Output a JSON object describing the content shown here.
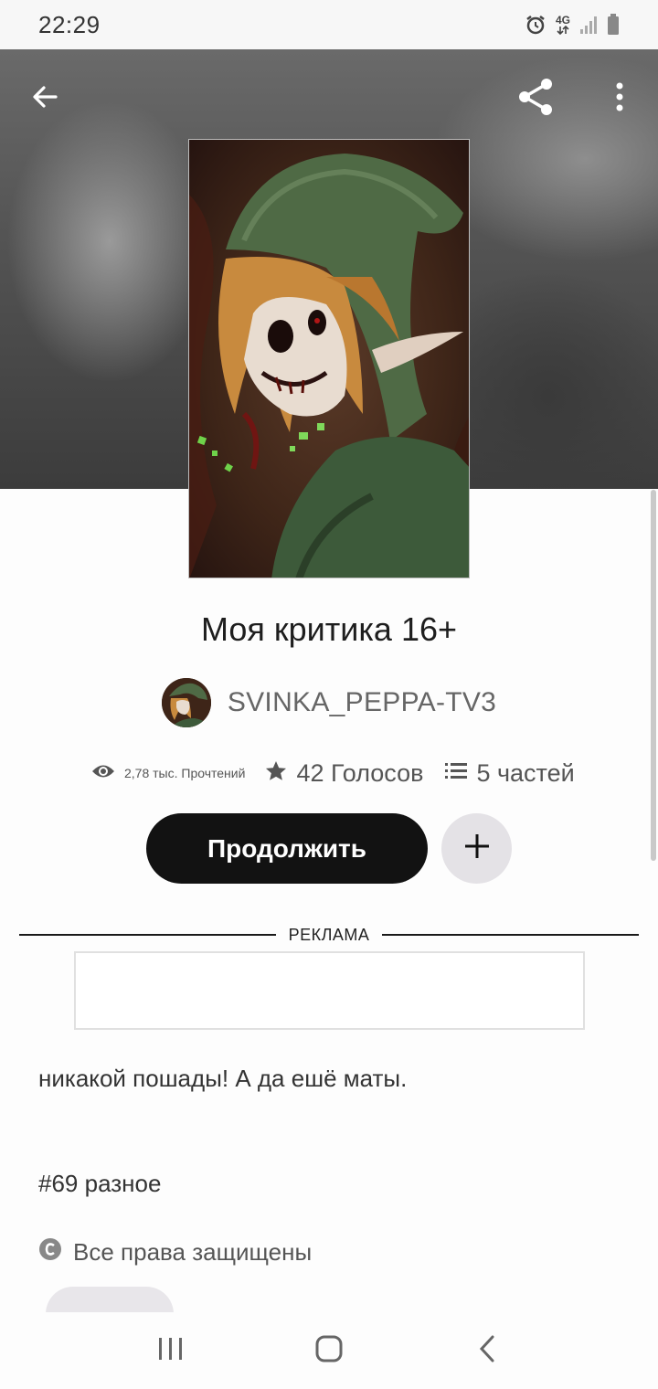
{
  "status_bar": {
    "time": "22:29",
    "network": "4G",
    "icons": [
      "alarm-icon",
      "network-4g-icon",
      "signal-icon",
      "battery-icon"
    ]
  },
  "header": {
    "back_icon": "arrow-left-icon",
    "share_icon": "share-icon",
    "more_icon": "more-vertical-icon"
  },
  "story": {
    "title": "Моя критика 16+",
    "author": "SVINKA_PEPPA-TV3",
    "reads": "2,78 тыс. Прочтений",
    "votes": "42 Голосов",
    "parts": "5 частей",
    "description": "никакой пошады! А да ешё маты.",
    "tag": "#69 разное",
    "copyright": "Все права защищены"
  },
  "actions": {
    "continue_label": "Продолжить",
    "add_icon": "plus-icon"
  },
  "ad": {
    "label": "РЕКЛАМА"
  },
  "nav": {
    "icons": [
      "recents-icon",
      "home-icon",
      "back-icon"
    ]
  },
  "colors": {
    "primary_button": "#121212",
    "secondary_button": "#e4e2e6",
    "text": "#222222",
    "muted_text": "#555555"
  }
}
